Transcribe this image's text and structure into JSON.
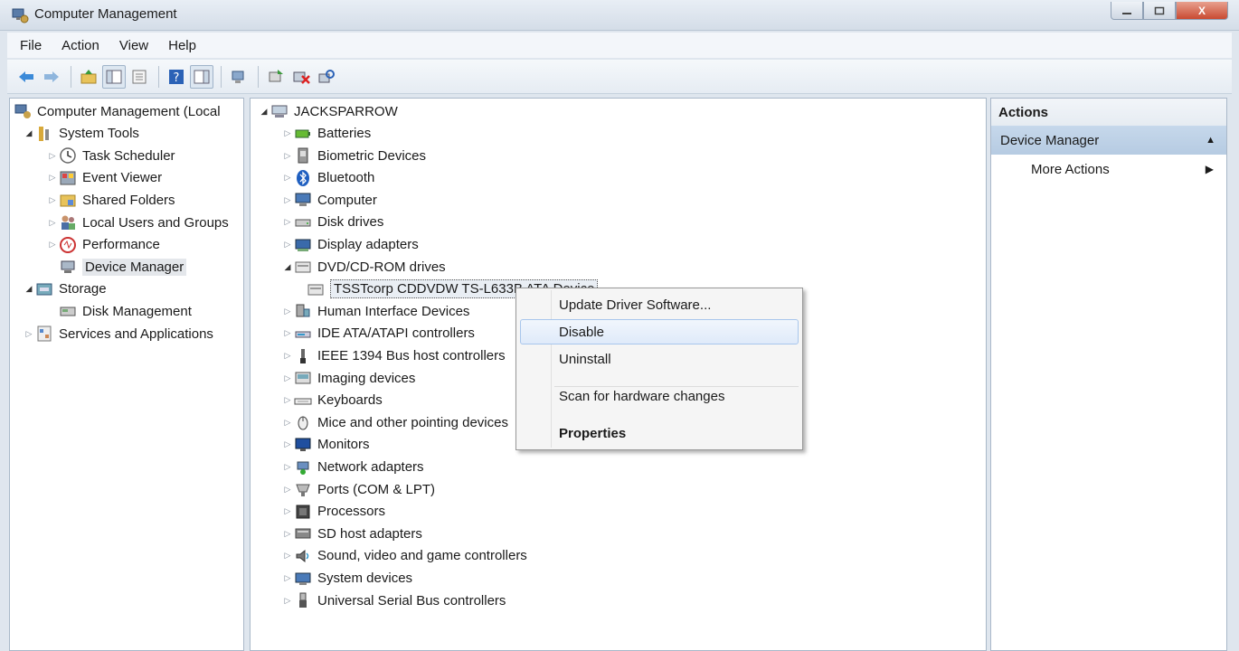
{
  "window": {
    "title": "Computer Management",
    "close_label": "X"
  },
  "menu": [
    "File",
    "Action",
    "View",
    "Help"
  ],
  "left_tree": [
    {
      "label": "Computer Management (Local",
      "icon": "computer-management-icon",
      "arrow": "",
      "level": 0
    },
    {
      "label": "System Tools",
      "icon": "system-tools-icon",
      "arrow": "open",
      "level": 1
    },
    {
      "label": "Task Scheduler",
      "icon": "clock-icon",
      "arrow": "closed",
      "level": 2
    },
    {
      "label": "Event Viewer",
      "icon": "event-viewer-icon",
      "arrow": "closed",
      "level": 2
    },
    {
      "label": "Shared Folders",
      "icon": "shared-folder-icon",
      "arrow": "closed",
      "level": 2
    },
    {
      "label": "Local Users and Groups",
      "icon": "users-icon",
      "arrow": "closed",
      "level": 2
    },
    {
      "label": "Performance",
      "icon": "performance-icon",
      "arrow": "closed",
      "level": 2
    },
    {
      "label": "Device Manager",
      "icon": "device-manager-icon",
      "arrow": "",
      "level": 2,
      "selected": true
    },
    {
      "label": "Storage",
      "icon": "storage-icon",
      "arrow": "open",
      "level": 1
    },
    {
      "label": "Disk Management",
      "icon": "disk-management-icon",
      "arrow": "",
      "level": 2
    },
    {
      "label": "Services and Applications",
      "icon": "services-icon",
      "arrow": "closed",
      "level": 1
    }
  ],
  "device_tree": {
    "root": "JACKSPARROW",
    "categories": [
      {
        "label": "Batteries",
        "icon": "battery-icon"
      },
      {
        "label": "Biometric Devices",
        "icon": "biometric-icon"
      },
      {
        "label": "Bluetooth",
        "icon": "bluetooth-icon"
      },
      {
        "label": "Computer",
        "icon": "computer-icon"
      },
      {
        "label": "Disk drives",
        "icon": "disk-drive-icon"
      },
      {
        "label": "Display adapters",
        "icon": "display-adapter-icon"
      },
      {
        "label": "DVD/CD-ROM drives",
        "icon": "dvd-drive-icon",
        "expanded": true
      },
      {
        "label": "TSSTcorp CDDVDW TS-L633B ATA Device",
        "icon": "dvd-drive-icon",
        "child": true
      },
      {
        "label": "Human Interface Devices",
        "icon": "hid-icon"
      },
      {
        "label": "IDE ATA/ATAPI controllers",
        "icon": "ide-controller-icon"
      },
      {
        "label": "IEEE 1394 Bus host controllers",
        "icon": "ieee1394-icon"
      },
      {
        "label": "Imaging devices",
        "icon": "imaging-icon"
      },
      {
        "label": "Keyboards",
        "icon": "keyboard-icon"
      },
      {
        "label": "Mice and other pointing devices",
        "icon": "mouse-icon"
      },
      {
        "label": "Monitors",
        "icon": "monitor-icon"
      },
      {
        "label": "Network adapters",
        "icon": "network-adapter-icon"
      },
      {
        "label": "Ports (COM & LPT)",
        "icon": "port-icon"
      },
      {
        "label": "Processors",
        "icon": "processor-icon"
      },
      {
        "label": "SD host adapters",
        "icon": "sd-adapter-icon"
      },
      {
        "label": "Sound, video and game controllers",
        "icon": "sound-icon"
      },
      {
        "label": "System devices",
        "icon": "system-device-icon"
      },
      {
        "label": "Universal Serial Bus controllers",
        "icon": "usb-icon"
      }
    ]
  },
  "actions": {
    "header": "Actions",
    "section": "Device Manager",
    "more": "More Actions"
  },
  "context_menu": [
    {
      "label": "Update Driver Software...",
      "bold": false
    },
    {
      "label": "Disable",
      "bold": false,
      "hover": true
    },
    {
      "label": "Uninstall",
      "bold": false
    },
    {
      "label": "Scan for hardware changes",
      "bold": false
    },
    {
      "label": "Properties",
      "bold": true
    }
  ],
  "colors": {
    "accent": "#b6cbe2",
    "selection": "#dfeafa",
    "frame": "#dfe6ee"
  }
}
